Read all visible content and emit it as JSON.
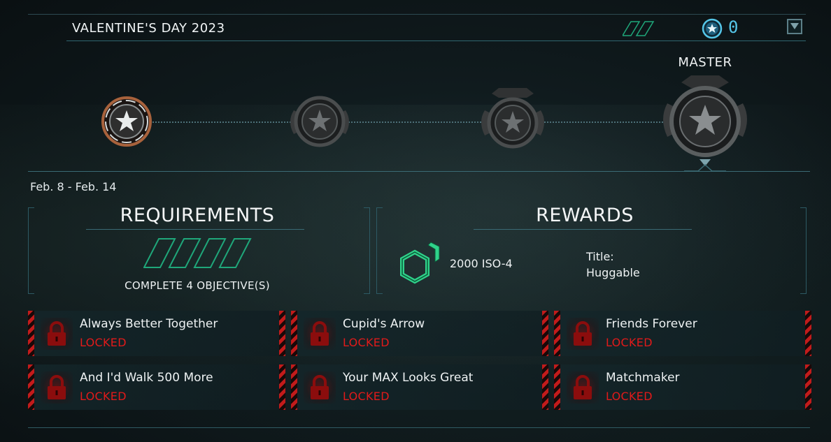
{
  "header": {
    "event_title": "VALENTINE'S DAY 2023",
    "coin_count": "0",
    "icons": {
      "progress": "double-slash-icon",
      "currency": "star-coin-icon",
      "collapse": "triangle-down-icon"
    }
  },
  "tiers": {
    "master_label": "MASTER",
    "count": 4,
    "unlocked": 1
  },
  "date_range": "Feb. 8 - Feb. 14",
  "requirements": {
    "title": "REQUIREMENTS",
    "objective_text": "COMPLETE 4 OBJECTIVE(S)",
    "progress_slots": 4,
    "progress_filled": 0
  },
  "rewards": {
    "title": "REWARDS",
    "currency_amount": "2000 ISO-4",
    "title_label": "Title:",
    "title_value": "Huggable"
  },
  "objectives": [
    {
      "name": "Always Better Together",
      "status": "LOCKED"
    },
    {
      "name": "Cupid's Arrow",
      "status": "LOCKED"
    },
    {
      "name": "Friends Forever",
      "status": "LOCKED"
    },
    {
      "name": "And I'd Walk 500 More",
      "status": "LOCKED"
    },
    {
      "name": "Your MAX Looks Great",
      "status": "LOCKED"
    },
    {
      "name": "Matchmaker",
      "status": "LOCKED"
    }
  ],
  "colors": {
    "accent_cyan": "#55c6e8",
    "locked_red": "#e11a1a",
    "progress_green": "#1fa77a",
    "tier_bronze": "#a8623c"
  }
}
